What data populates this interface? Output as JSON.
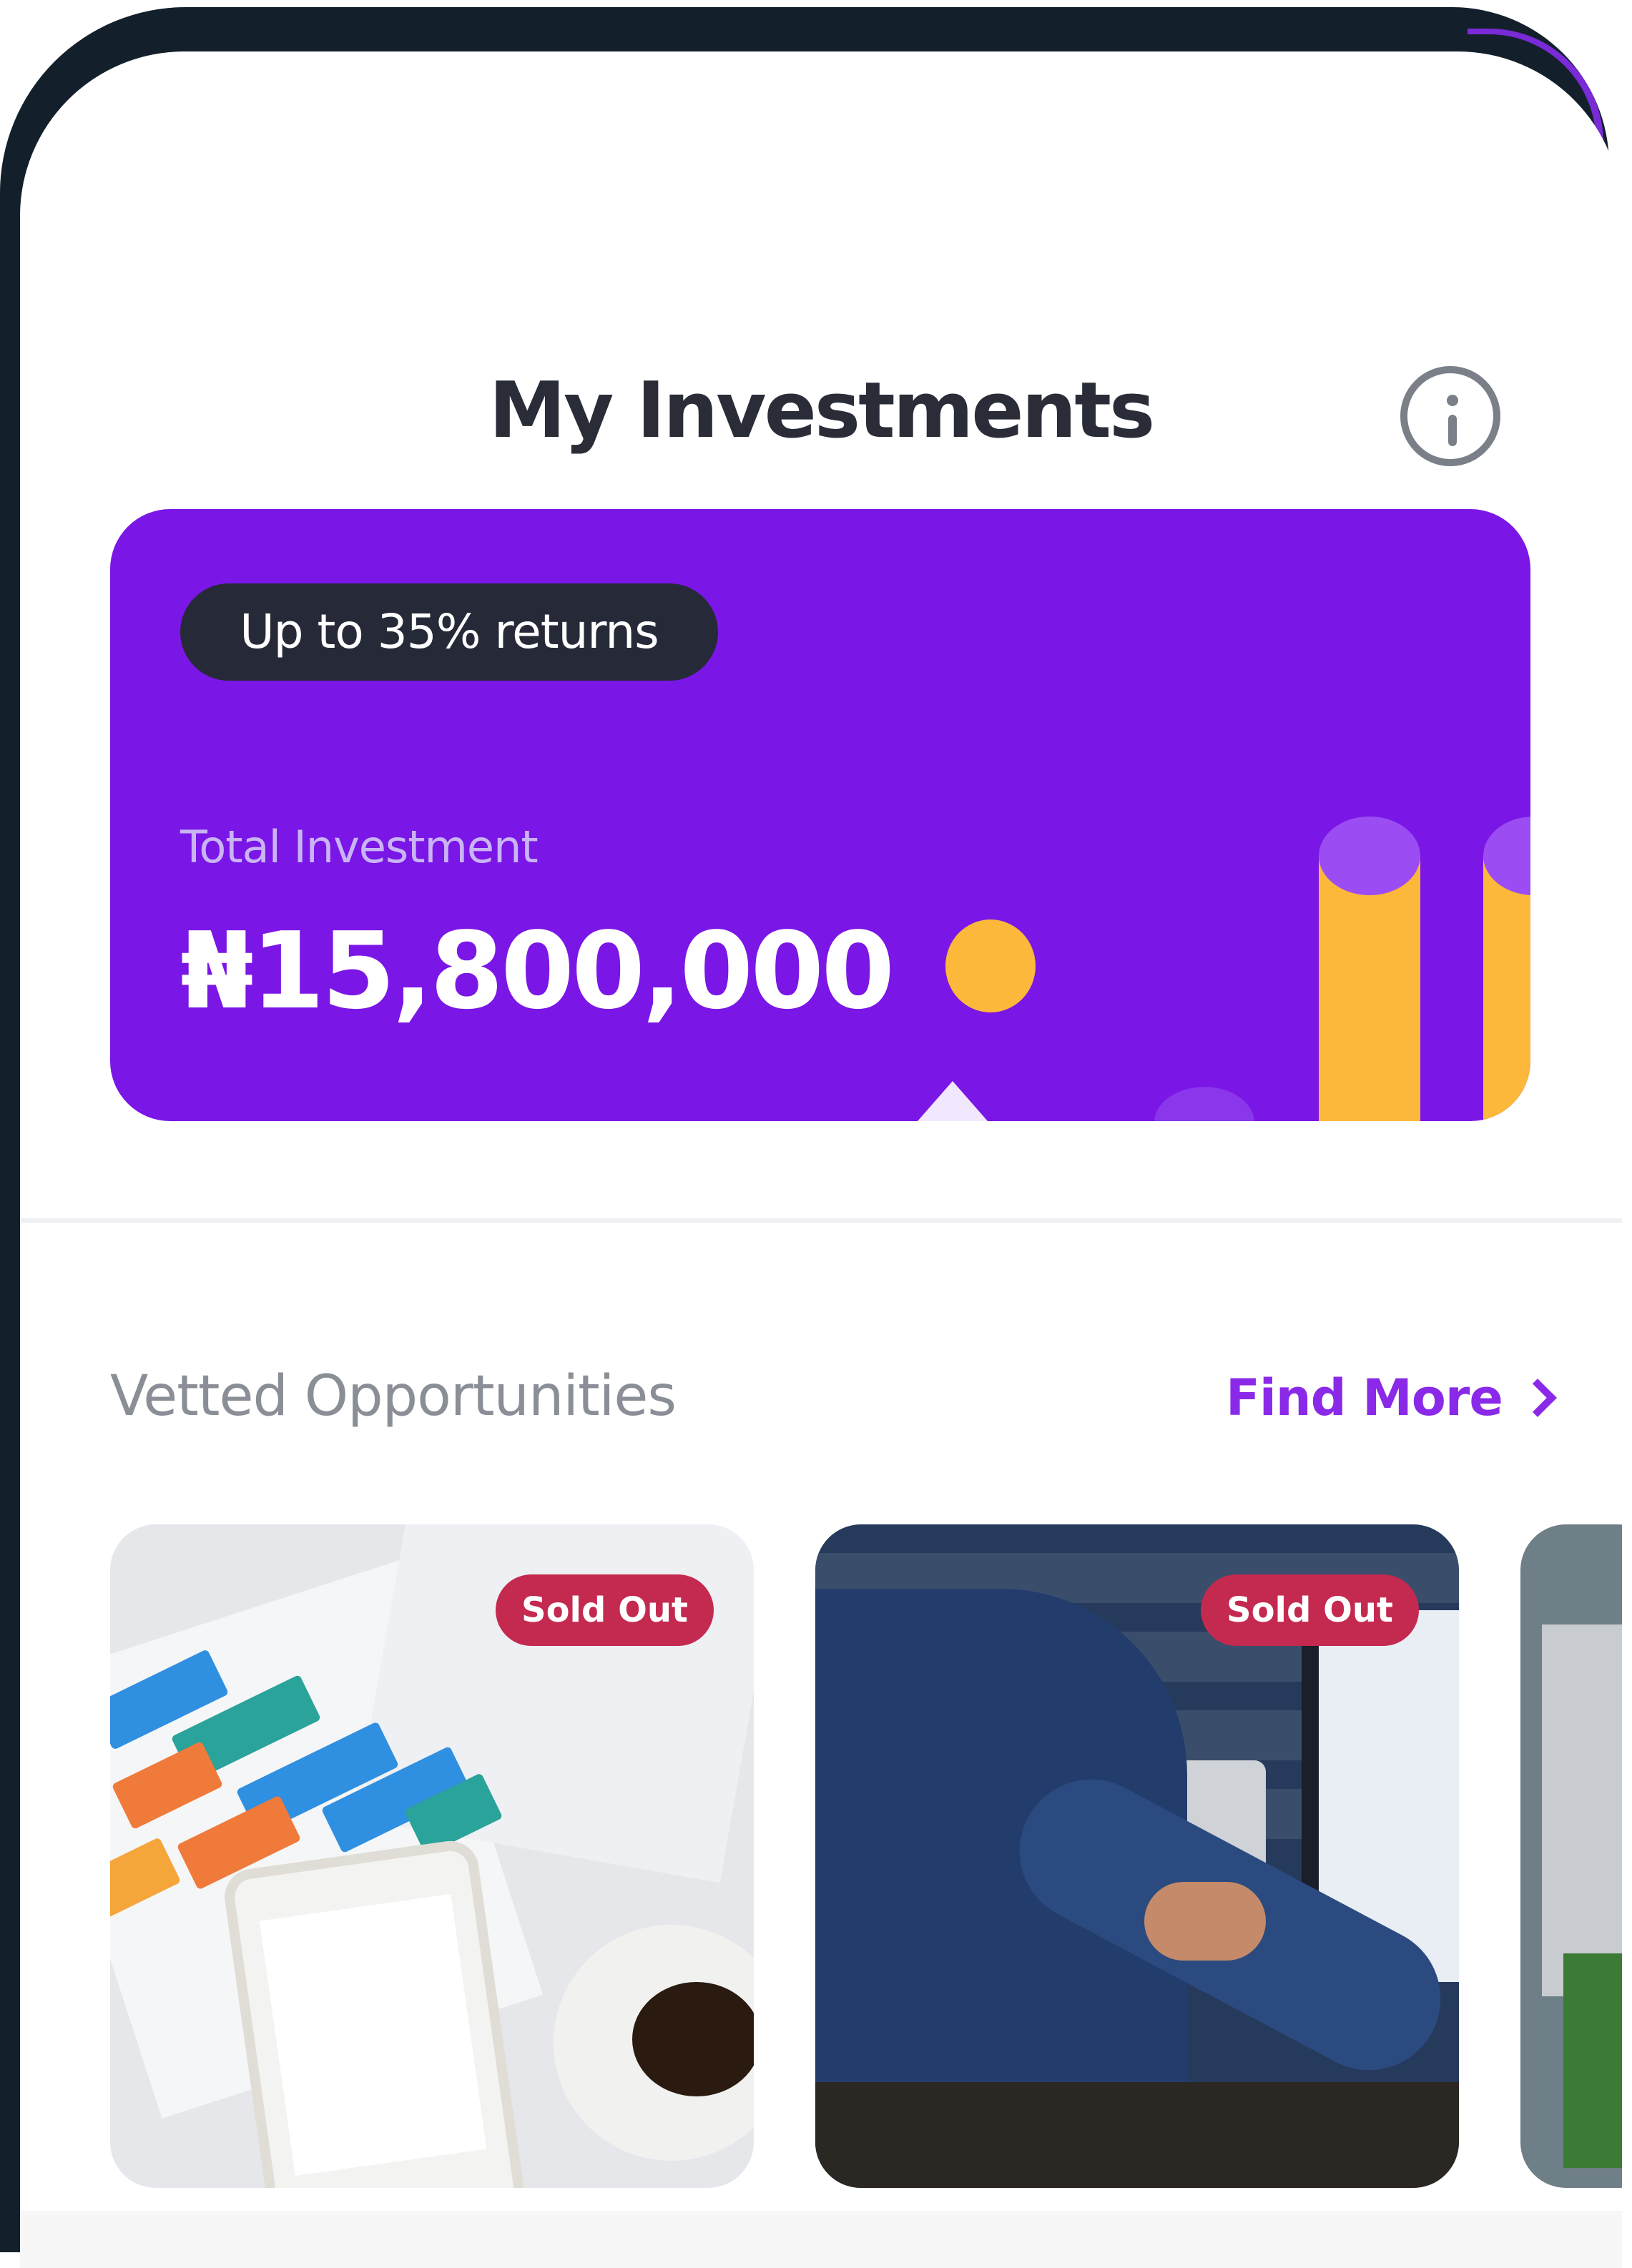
{
  "header": {
    "title": "My Investments",
    "info_icon": "info-circle-icon"
  },
  "investment_card": {
    "returns_badge": "Up to 35% returns",
    "total_label": "Total Investment",
    "total_amount": "₦15,800,000",
    "card_color": "#7a16e6",
    "accent_color": "#fbb83a"
  },
  "opportunities": {
    "title": "Vetted Opportunities",
    "find_more": "Find More",
    "find_more_icon": "chevron-right-icon",
    "find_more_color": "#8a2ae8",
    "items": [
      {
        "badge": "Sold Out",
        "image": "finance-charts-phone-coffee"
      },
      {
        "badge": "Sold Out",
        "image": "man-working-at-computer"
      },
      {
        "badge": "",
        "image": "aerial-building"
      }
    ],
    "badge_color": "#c4294f"
  }
}
